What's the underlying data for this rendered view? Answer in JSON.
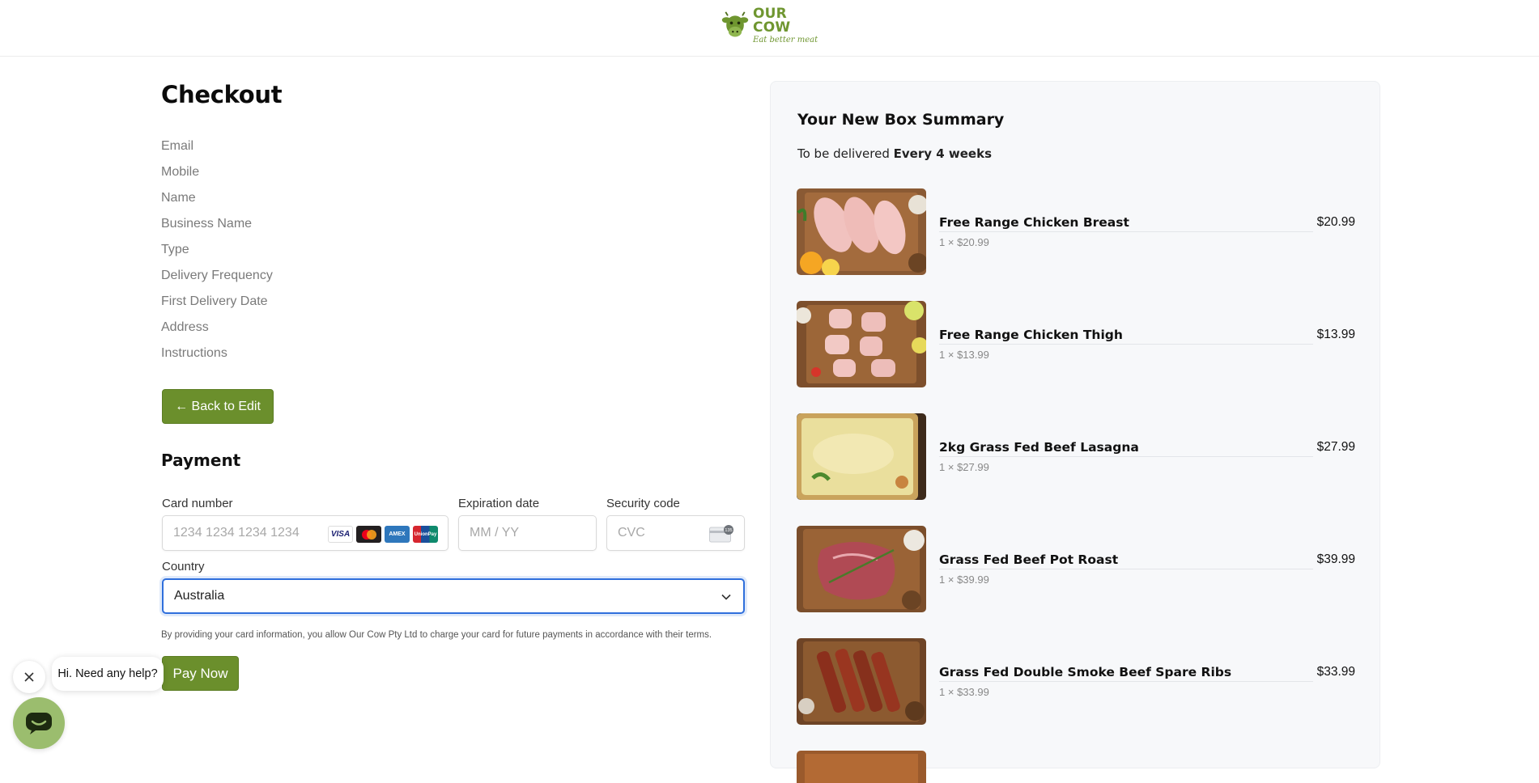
{
  "brand": {
    "name": "OUR COW",
    "tagline": "Eat better meat",
    "color": "#6f9630"
  },
  "checkout": {
    "title": "Checkout",
    "info_fields": [
      "Email",
      "Mobile",
      "Name",
      "Business Name",
      "Type",
      "Delivery Frequency",
      "First Delivery Date",
      "Address",
      "Instructions"
    ],
    "back_label": "← Back to Edit"
  },
  "payment": {
    "title": "Payment",
    "card_label": "Card number",
    "card_placeholder": "1234 1234 1234 1234",
    "card_brands": [
      "VISA",
      "MC",
      "AMEX",
      "UnionPay"
    ],
    "exp_label": "Expiration date",
    "exp_placeholder": "MM / YY",
    "cvc_label": "Security code",
    "cvc_placeholder": "CVC",
    "cvc_icon_text": "135",
    "country_label": "Country",
    "country_value": "Australia",
    "terms": "By providing your card information, you allow Our Cow Pty Ltd to charge your card for future payments in accordance with their terms.",
    "pay_label": "Pay Now"
  },
  "chat": {
    "prompt": "Hi. Need any help?"
  },
  "summary": {
    "title": "Your New Box Summary",
    "deliver_prefix": "To be delivered",
    "deliver_frequency": "Every 4 weeks",
    "items": [
      {
        "name": "Free Range Chicken Breast",
        "price": "$20.99",
        "qty": "1",
        "unit_price": "$20.99"
      },
      {
        "name": "Free Range Chicken Thigh",
        "price": "$13.99",
        "qty": "1",
        "unit_price": "$13.99"
      },
      {
        "name": "2kg Grass Fed Beef Lasagna",
        "price": "$27.99",
        "qty": "1",
        "unit_price": "$27.99"
      },
      {
        "name": "Grass Fed Beef Pot Roast",
        "price": "$39.99",
        "qty": "1",
        "unit_price": "$39.99"
      },
      {
        "name": "Grass Fed Double Smoke Beef Spare Ribs",
        "price": "$33.99",
        "qty": "1",
        "unit_price": "$33.99"
      }
    ]
  },
  "colors": {
    "accent": "#6b8f2c",
    "focus": "#2f6fdc",
    "panel": "#f7f8fa"
  }
}
